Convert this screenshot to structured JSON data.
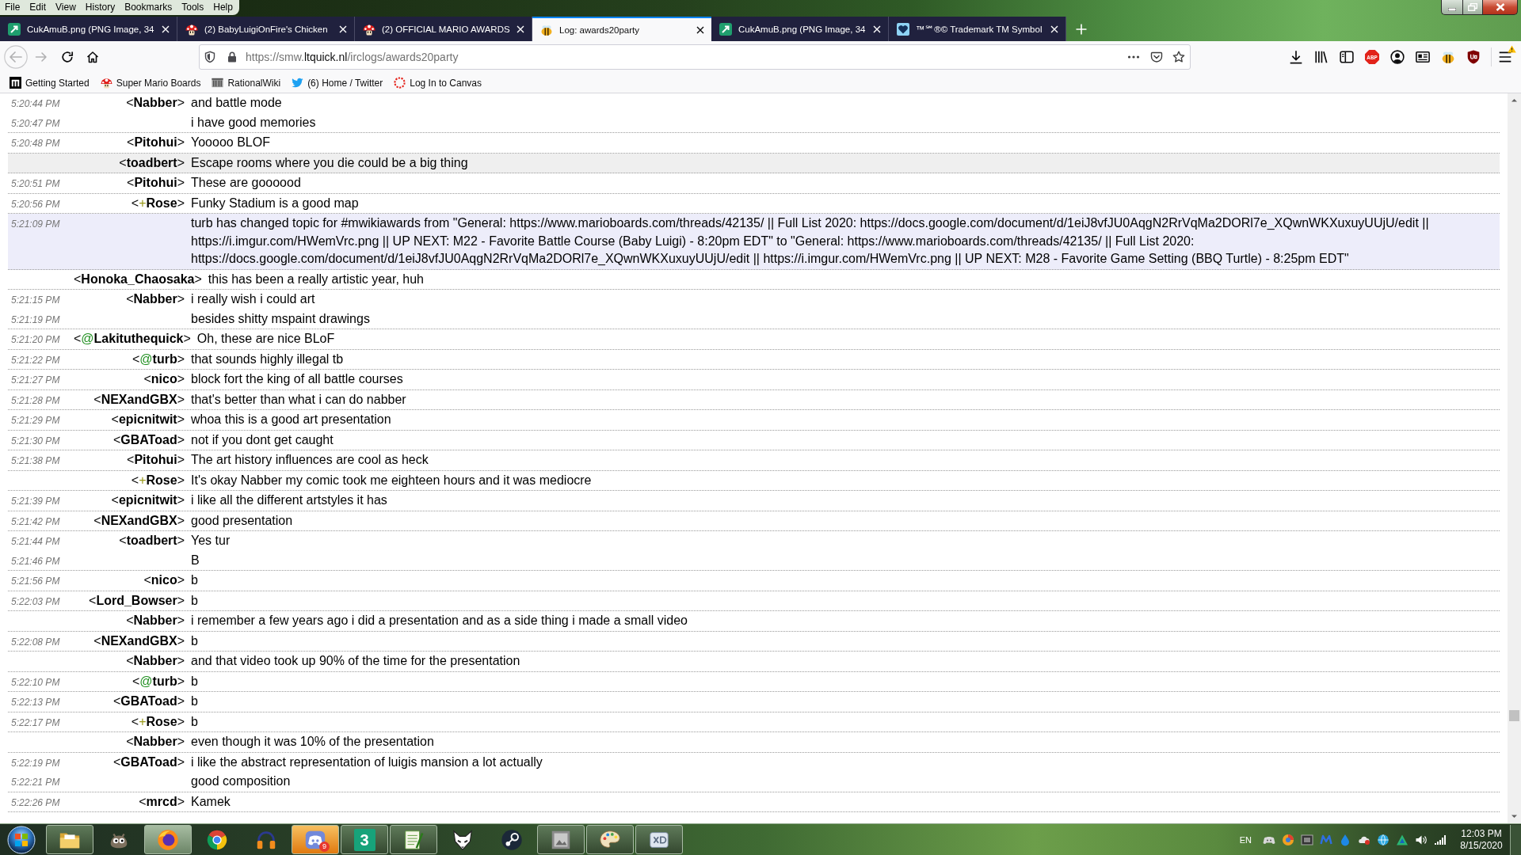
{
  "menu": [
    "File",
    "Edit",
    "View",
    "History",
    "Bookmarks",
    "Tools",
    "Help"
  ],
  "tabs": [
    {
      "kind": "arrow-tile",
      "title": "CukAmuB.png (PNG Image, 34",
      "selected": false
    },
    {
      "kind": "mushroom",
      "title": "(2) BabyLuigiOnFire's Chicken",
      "selected": false
    },
    {
      "kind": "mushroom",
      "title": "(2) OFFICIAL MARIO AWARDS",
      "selected": false
    },
    {
      "kind": "bee",
      "title": "Log: awards20party",
      "selected": true
    },
    {
      "kind": "arrow-tile",
      "title": "CukAmuB.png (PNG Image, 34",
      "selected": false
    },
    {
      "kind": "heart",
      "title": "™℠®© Trademark TM Symbol",
      "selected": false
    }
  ],
  "nav_buttons": [
    {
      "kind": "back",
      "disabled": true
    },
    {
      "kind": "forward",
      "disabled": true
    },
    {
      "kind": "reload",
      "disabled": false
    },
    {
      "kind": "home",
      "disabled": false
    }
  ],
  "address": {
    "start": "https://smw.",
    "domain": "ltquick.nl",
    "rest": "/irclogs/awards20party"
  },
  "extensions": [
    {
      "kind": "download"
    },
    {
      "kind": "library"
    },
    {
      "kind": "sidebar"
    },
    {
      "kind": "abp",
      "label": "ABP"
    },
    {
      "kind": "account"
    },
    {
      "kind": "reader"
    },
    {
      "kind": "bee"
    },
    {
      "kind": "ublock"
    }
  ],
  "menu_button": {
    "warning": true
  },
  "bookmarks": [
    {
      "kind": "square",
      "label": "Getting Started"
    },
    {
      "kind": "mushroom",
      "label": "Super Mario Boards"
    },
    {
      "kind": "building",
      "label": "RationalWiki"
    },
    {
      "kind": "bird",
      "label": "(6) Home / Twitter"
    },
    {
      "kind": "ring",
      "label": "Log In to Canvas"
    }
  ],
  "log": {
    "entries": [
      {
        "kind": "message",
        "highlighted": false,
        "nick": {
          "open": "<",
          "name": "Nabber",
          "close": ">"
        },
        "lines": [
          {
            "time": "5:20:44 PM",
            "text": "and battle mode"
          },
          {
            "time": "5:20:47 PM",
            "text": "i have good memories"
          }
        ]
      },
      {
        "kind": "message",
        "highlighted": false,
        "nick": {
          "open": "<",
          "name": "Pitohui",
          "close": ">"
        },
        "lines": [
          {
            "time": "5:20:48 PM",
            "text": "Yooooo BLOF"
          }
        ]
      },
      {
        "kind": "message",
        "highlighted": true,
        "nick": {
          "open": "<",
          "name": "toadbert",
          "close": ">"
        },
        "lines": [
          {
            "text": "Escape rooms where you die could be a big thing"
          }
        ]
      },
      {
        "kind": "message",
        "highlighted": false,
        "nick": {
          "open": "<",
          "name": "Pitohui",
          "close": ">"
        },
        "lines": [
          {
            "time": "5:20:51 PM",
            "text": "These are goooood"
          }
        ]
      },
      {
        "kind": "message",
        "highlighted": false,
        "nick": {
          "open": "<",
          "mode": {
            "text": "+",
            "color": "#9a9a1c"
          },
          "name": "Rose",
          "close": ">"
        },
        "lines": [
          {
            "time": "5:20:56 PM",
            "text": "Funky Stadium is a good map"
          }
        ]
      },
      {
        "kind": "topic",
        "highlighted": false,
        "lines": [
          {
            "time": "5:21:09 PM",
            "text": "turb has changed topic for #mwikiawards from \"General: https://www.marioboards.com/threads/42135/ || Full List 2020: https://docs.google.com/document/d/1eiJ8vfJU0AqgN2RrVqMa2DORl7e_XQwnWKXuxuyUUjU/edit || https://i.imgur.com/HWemVrc.png || UP NEXT: M22 - Favorite Battle Course (Baby Luigi) - 8:20pm EDT\" to \"General: https://www.marioboards.com/threads/42135/ || Full List 2020: https://docs.google.com/document/d/1eiJ8vfJU0AqgN2RrVqMa2DORl7e_XQwnWKXuxuyUUjU/edit || https://i.imgur.com/HWemVrc.png || UP NEXT: M28 - Favorite Game Setting (BBQ Turtle) - 8:25pm EDT\""
          }
        ]
      },
      {
        "kind": "message",
        "highlighted": false,
        "nick": {
          "open": "<",
          "name": "Honoka_Chaosaka",
          "close": ">"
        },
        "lines": [
          {
            "text": "this has been a really artistic year, huh"
          }
        ]
      },
      {
        "kind": "message",
        "highlighted": false,
        "nick": {
          "open": "<",
          "name": "Nabber",
          "close": ">"
        },
        "lines": [
          {
            "time": "5:21:15 PM",
            "text": "i really wish i could art"
          },
          {
            "time": "5:21:19 PM",
            "text": "besides shitty mspaint drawings"
          }
        ]
      },
      {
        "kind": "message",
        "highlighted": false,
        "nick": {
          "open": "<",
          "mode": {
            "text": "@",
            "color": "#1f8f1f"
          },
          "name": "Lakituthequick",
          "close": ">"
        },
        "lines": [
          {
            "time": "5:21:20 PM",
            "text": "Oh, these are nice BLoF"
          }
        ]
      },
      {
        "kind": "message",
        "highlighted": false,
        "nick": {
          "open": "<",
          "mode": {
            "text": "@",
            "color": "#1f8f1f"
          },
          "name": "turb",
          "close": ">"
        },
        "lines": [
          {
            "time": "5:21:22 PM",
            "text": "that sounds highly illegal tb"
          }
        ]
      },
      {
        "kind": "message",
        "highlighted": false,
        "nick": {
          "open": "<",
          "name": "nico",
          "close": ">"
        },
        "lines": [
          {
            "time": "5:21:27 PM",
            "text": "block fort the king of all battle courses"
          }
        ]
      },
      {
        "kind": "message",
        "highlighted": false,
        "nick": {
          "open": "<",
          "name": "NEXandGBX",
          "close": ">"
        },
        "lines": [
          {
            "time": "5:21:28 PM",
            "text": "that's better than what i can do nabber"
          }
        ]
      },
      {
        "kind": "message",
        "highlighted": false,
        "nick": {
          "open": "<",
          "name": "epicnitwit",
          "close": ">"
        },
        "lines": [
          {
            "time": "5:21:29 PM",
            "text": "whoa this is a good art presentation"
          }
        ]
      },
      {
        "kind": "message",
        "highlighted": false,
        "nick": {
          "open": "<",
          "name": "GBAToad",
          "close": ">"
        },
        "lines": [
          {
            "time": "5:21:30 PM",
            "text": "not if you dont get caught"
          }
        ]
      },
      {
        "kind": "message",
        "highlighted": false,
        "nick": {
          "open": "<",
          "name": "Pitohui",
          "close": ">"
        },
        "lines": [
          {
            "time": "5:21:38 PM",
            "text": "The art history influences are cool as heck"
          }
        ]
      },
      {
        "kind": "message",
        "highlighted": false,
        "nick": {
          "open": "<",
          "mode": {
            "text": "+",
            "color": "#9a9a1c"
          },
          "name": "Rose",
          "close": ">"
        },
        "lines": [
          {
            "text": "It's okay Nabber my comic took me eighteen hours and it was mediocre"
          }
        ]
      },
      {
        "kind": "message",
        "highlighted": false,
        "nick": {
          "open": "<",
          "name": "epicnitwit",
          "close": ">"
        },
        "lines": [
          {
            "time": "5:21:39 PM",
            "text": "i like all the different artstyles it has"
          }
        ]
      },
      {
        "kind": "message",
        "highlighted": false,
        "nick": {
          "open": "<",
          "name": "NEXandGBX",
          "close": ">"
        },
        "lines": [
          {
            "time": "5:21:42 PM",
            "text": "good presentation"
          }
        ]
      },
      {
        "kind": "message",
        "highlighted": false,
        "nick": {
          "open": "<",
          "name": "toadbert",
          "close": ">"
        },
        "lines": [
          {
            "time": "5:21:44 PM",
            "text": "Yes tur"
          },
          {
            "time": "5:21:46 PM",
            "text": "B"
          }
        ]
      },
      {
        "kind": "message",
        "highlighted": false,
        "nick": {
          "open": "<",
          "name": "nico",
          "close": ">"
        },
        "lines": [
          {
            "time": "5:21:56 PM",
            "text": "b"
          }
        ]
      },
      {
        "kind": "message",
        "highlighted": false,
        "nick": {
          "open": "<",
          "name": "Lord_Bowser",
          "close": ">"
        },
        "lines": [
          {
            "time": "5:22:03 PM",
            "text": "b"
          }
        ]
      },
      {
        "kind": "message",
        "highlighted": false,
        "nick": {
          "open": "<",
          "name": "Nabber",
          "close": ">"
        },
        "lines": [
          {
            "text": "i remember a few years ago i did a presentation and as a side thing i made a small video"
          }
        ]
      },
      {
        "kind": "message",
        "highlighted": false,
        "nick": {
          "open": "<",
          "name": "NEXandGBX",
          "close": ">"
        },
        "lines": [
          {
            "time": "5:22:08 PM",
            "text": "b"
          }
        ]
      },
      {
        "kind": "message",
        "highlighted": false,
        "nick": {
          "open": "<",
          "name": "Nabber",
          "close": ">"
        },
        "lines": [
          {
            "text": "and that video took up 90% of the time for the presentation"
          }
        ]
      },
      {
        "kind": "message",
        "highlighted": false,
        "nick": {
          "open": "<",
          "mode": {
            "text": "@",
            "color": "#1f8f1f"
          },
          "name": "turb",
          "close": ">"
        },
        "lines": [
          {
            "time": "5:22:10 PM",
            "text": "b"
          }
        ]
      },
      {
        "kind": "message",
        "highlighted": false,
        "nick": {
          "open": "<",
          "name": "GBAToad",
          "close": ">"
        },
        "lines": [
          {
            "time": "5:22:13 PM",
            "text": "b"
          }
        ]
      },
      {
        "kind": "message",
        "highlighted": false,
        "nick": {
          "open": "<",
          "mode": {
            "text": "+",
            "color": "#9a9a1c"
          },
          "name": "Rose",
          "close": ">"
        },
        "lines": [
          {
            "time": "5:22:17 PM",
            "text": "b"
          }
        ]
      },
      {
        "kind": "message",
        "highlighted": false,
        "nick": {
          "open": "<",
          "name": "Nabber",
          "close": ">"
        },
        "lines": [
          {
            "text": "even though it was 10% of the presentation"
          }
        ]
      },
      {
        "kind": "message",
        "highlighted": false,
        "nick": {
          "open": "<",
          "name": "GBAToad",
          "close": ">"
        },
        "lines": [
          {
            "time": "5:22:19 PM",
            "text": "i like the abstract representation of luigis mansion a lot actually"
          },
          {
            "time": "5:22:21 PM",
            "text": "good composition"
          }
        ]
      },
      {
        "kind": "message",
        "highlighted": false,
        "nick": {
          "open": "<",
          "name": "mrcd",
          "close": ">"
        },
        "lines": [
          {
            "time": "5:22:26 PM",
            "text": "Kamek"
          }
        ]
      }
    ]
  },
  "taskbar": {
    "apps": [
      {
        "kind": "folder",
        "running": true,
        "selected": false,
        "flashing": false
      },
      {
        "kind": "creature",
        "running": false,
        "selected": false,
        "flashing": false
      },
      {
        "kind": "firefox",
        "running": true,
        "selected": true,
        "flashing": false
      },
      {
        "kind": "chrome",
        "running": false,
        "selected": false,
        "flashing": false
      },
      {
        "kind": "headphones",
        "running": false,
        "selected": false,
        "flashing": false
      },
      {
        "kind": "discord",
        "running": true,
        "selected": false,
        "flashing": true,
        "badge": "9"
      },
      {
        "kind": "number-tile",
        "running": true,
        "selected": false,
        "flashing": false,
        "label": "3"
      },
      {
        "kind": "notepad",
        "running": true,
        "selected": false,
        "flashing": false
      },
      {
        "kind": "fox-mask",
        "running": false,
        "selected": false,
        "flashing": false
      },
      {
        "kind": "steam",
        "running": false,
        "selected": false,
        "flashing": false
      },
      {
        "kind": "picture",
        "running": true,
        "selected": false,
        "flashing": false
      },
      {
        "kind": "palette",
        "running": true,
        "selected": false,
        "flashing": false
      },
      {
        "kind": "xd",
        "running": true,
        "selected": false,
        "flashing": false
      }
    ],
    "language": "EN",
    "tray": [
      {
        "kind": "controller"
      },
      {
        "kind": "ball"
      },
      {
        "kind": "chip"
      },
      {
        "kind": "zigzag"
      },
      {
        "kind": "drop"
      },
      {
        "kind": "cloud"
      },
      {
        "kind": "globe"
      },
      {
        "kind": "triangle"
      },
      {
        "kind": "speaker"
      },
      {
        "kind": "signal"
      }
    ],
    "clock": {
      "time": "12:03 PM",
      "date": "8/15/2020"
    }
  }
}
